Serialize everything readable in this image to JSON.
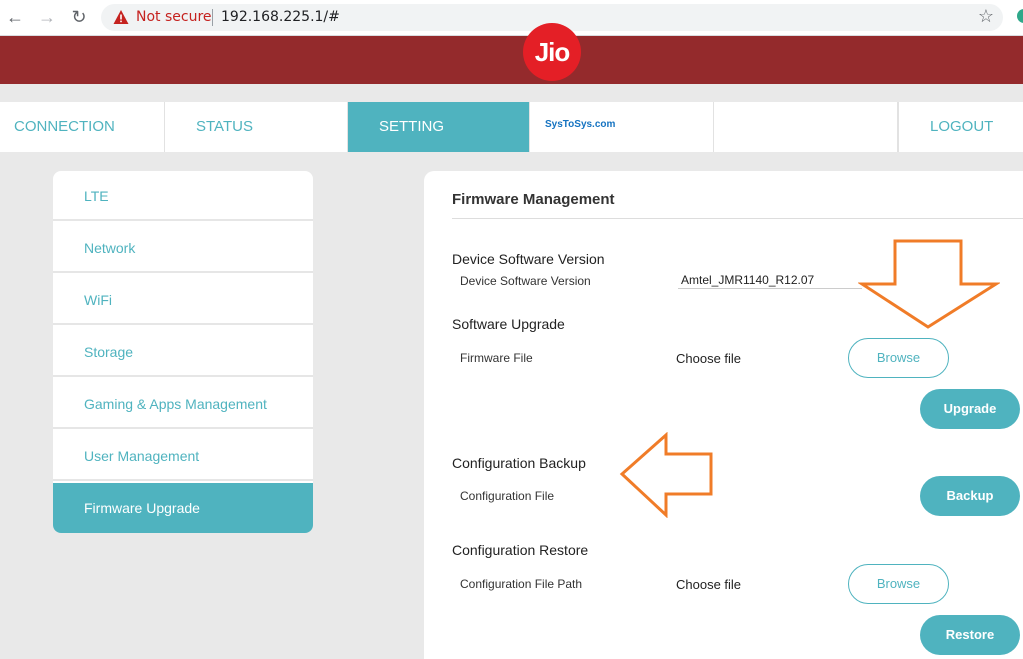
{
  "browser": {
    "security_label": "Not secure",
    "url": "192.168.225.1/#"
  },
  "brand": {
    "logo_text": "Jio",
    "color": "#942a2c",
    "logo_color": "#e41f26"
  },
  "accent_color": "#4fb3bf",
  "tabs": [
    {
      "label": "CONNECTION"
    },
    {
      "label": "STATUS"
    },
    {
      "label": "SETTING"
    },
    {
      "label": ""
    },
    {
      "label": "LOGOUT"
    }
  ],
  "watermark": "SysToSys.com",
  "sidebar": {
    "items": [
      {
        "label": "LTE"
      },
      {
        "label": "Network"
      },
      {
        "label": "WiFi"
      },
      {
        "label": "Storage"
      },
      {
        "label": "Gaming & Apps Management"
      },
      {
        "label": "User Management"
      },
      {
        "label": "Firmware Upgrade"
      }
    ]
  },
  "panel": {
    "title": "Firmware Management",
    "device_version": {
      "section": "Device Software Version",
      "label": "Device Software Version",
      "value": "Amtel_JMR1140_R12.07"
    },
    "software_upgrade": {
      "section": "Software Upgrade",
      "label": "Firmware File",
      "choose": "Choose file",
      "browse": "Browse",
      "upgrade": "Upgrade"
    },
    "config_backup": {
      "section": "Configuration Backup",
      "label": "Configuration File",
      "backup": "Backup"
    },
    "config_restore": {
      "section": "Configuration Restore",
      "label": "Configuration File Path",
      "choose": "Choose file",
      "browse": "Browse",
      "restore": "Restore"
    }
  }
}
